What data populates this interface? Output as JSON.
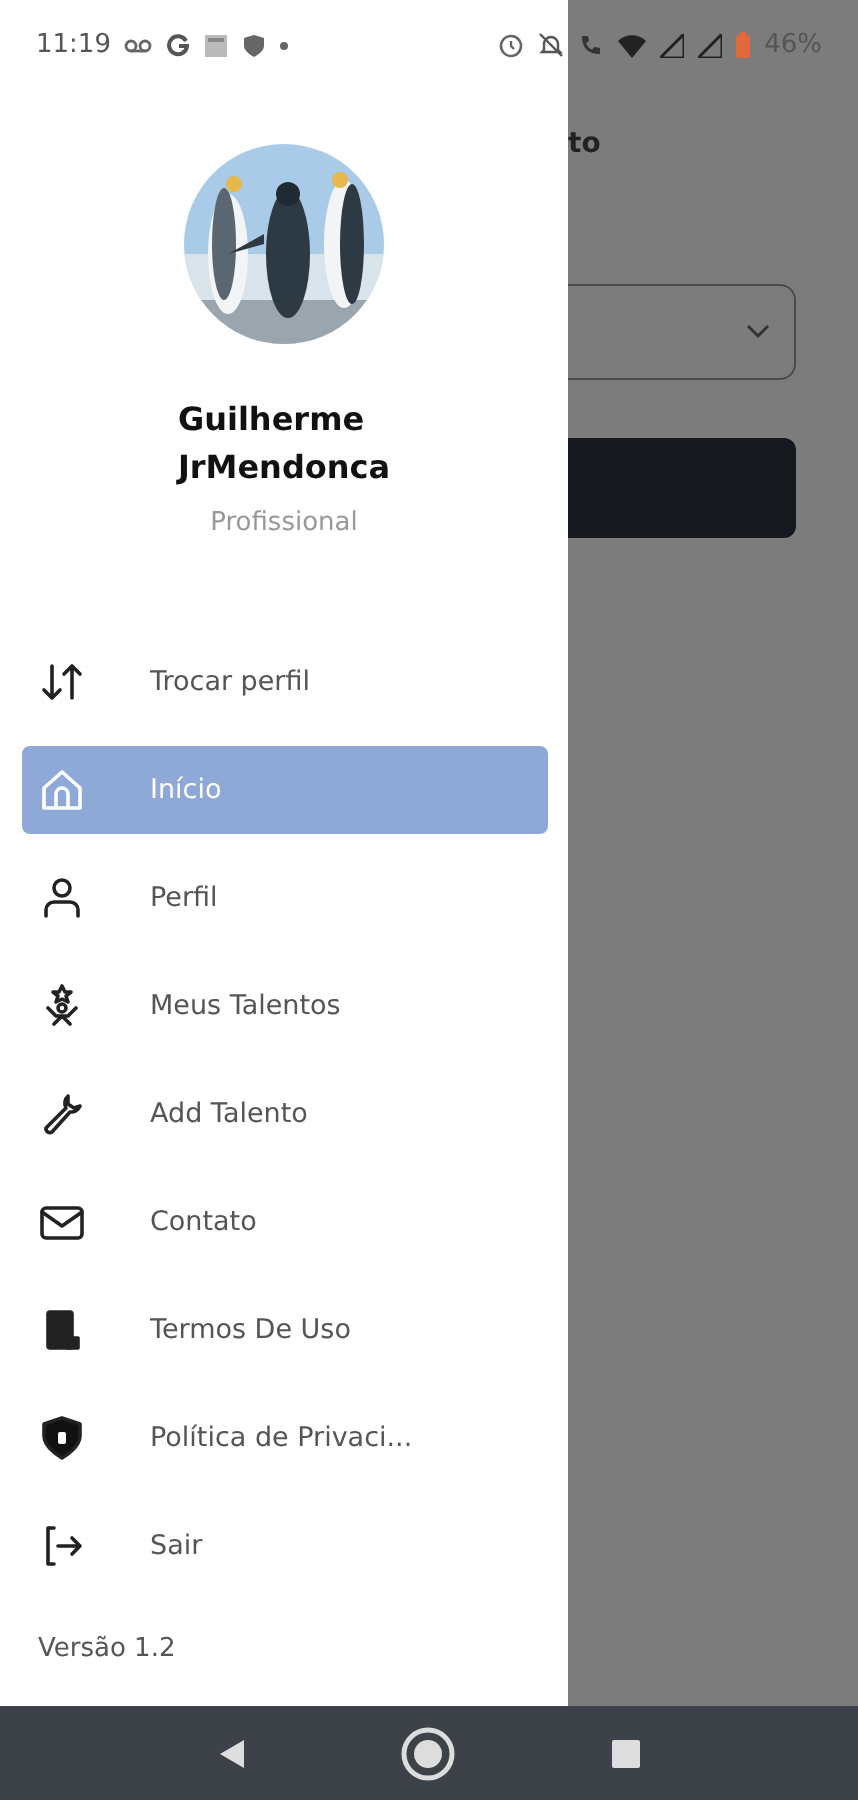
{
  "status_bar": {
    "time": "11:19",
    "battery": "46%"
  },
  "profile": {
    "name_line1": "Guilherme",
    "name_line2": "JrMendonca",
    "role": "Profissional"
  },
  "menu": [
    {
      "label": "Trocar perfil",
      "selected": false
    },
    {
      "label": "Início",
      "selected": true
    },
    {
      "label": "Perfil",
      "selected": false
    },
    {
      "label": "Meus Talentos",
      "selected": false
    },
    {
      "label": "Add Talento",
      "selected": false
    },
    {
      "label": "Contato",
      "selected": false
    },
    {
      "label": "Termos De Uso",
      "selected": false
    },
    {
      "label": "Política de Privaci...",
      "selected": false
    },
    {
      "label": "Sair",
      "selected": false
    }
  ],
  "version": "Versão 1.2",
  "background_screen": {
    "title_fragment": "to"
  }
}
